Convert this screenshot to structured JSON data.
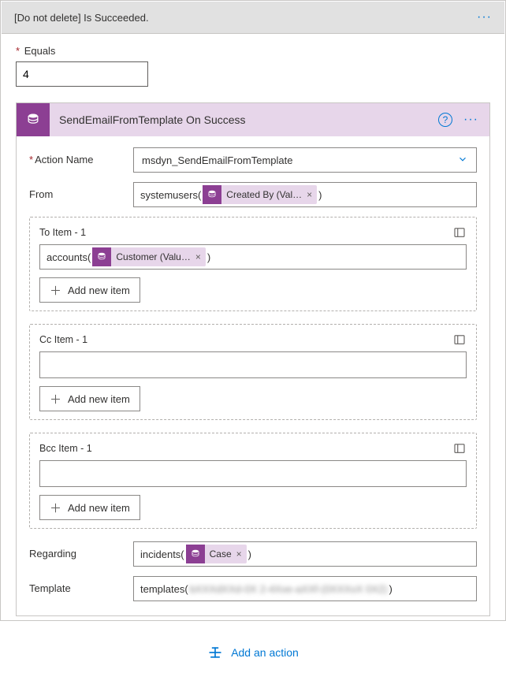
{
  "header": {
    "title": "[Do not delete] Is Succeeded."
  },
  "equals": {
    "label": "Equals",
    "value": "4"
  },
  "card": {
    "title": "SendEmailFromTemplate On Success",
    "fields": {
      "actionName": {
        "label": "Action Name",
        "value": "msdyn_SendEmailFromTemplate"
      },
      "from": {
        "label": "From",
        "prefix": "systemusers(",
        "token": "Created By (Val…",
        "suffix": ")"
      },
      "to": {
        "title": "To Item - 1",
        "prefix": "accounts(",
        "token": "Customer (Valu…",
        "suffix": ")",
        "addLabel": "Add new item"
      },
      "cc": {
        "title": "Cc Item - 1",
        "addLabel": "Add new item"
      },
      "bcc": {
        "title": "Bcc Item - 1",
        "addLabel": "Add new item"
      },
      "regarding": {
        "label": "Regarding",
        "prefix": "incidents(",
        "token": "Case",
        "suffix": ")"
      },
      "template": {
        "label": "Template",
        "prefix": "templates(",
        "blur": "bXXXdXXd-0X 2-4Xxe-aXXf-(0XXXxX 0X2)",
        "suffix": ")"
      }
    }
  },
  "addAction": {
    "label": "Add an action"
  }
}
